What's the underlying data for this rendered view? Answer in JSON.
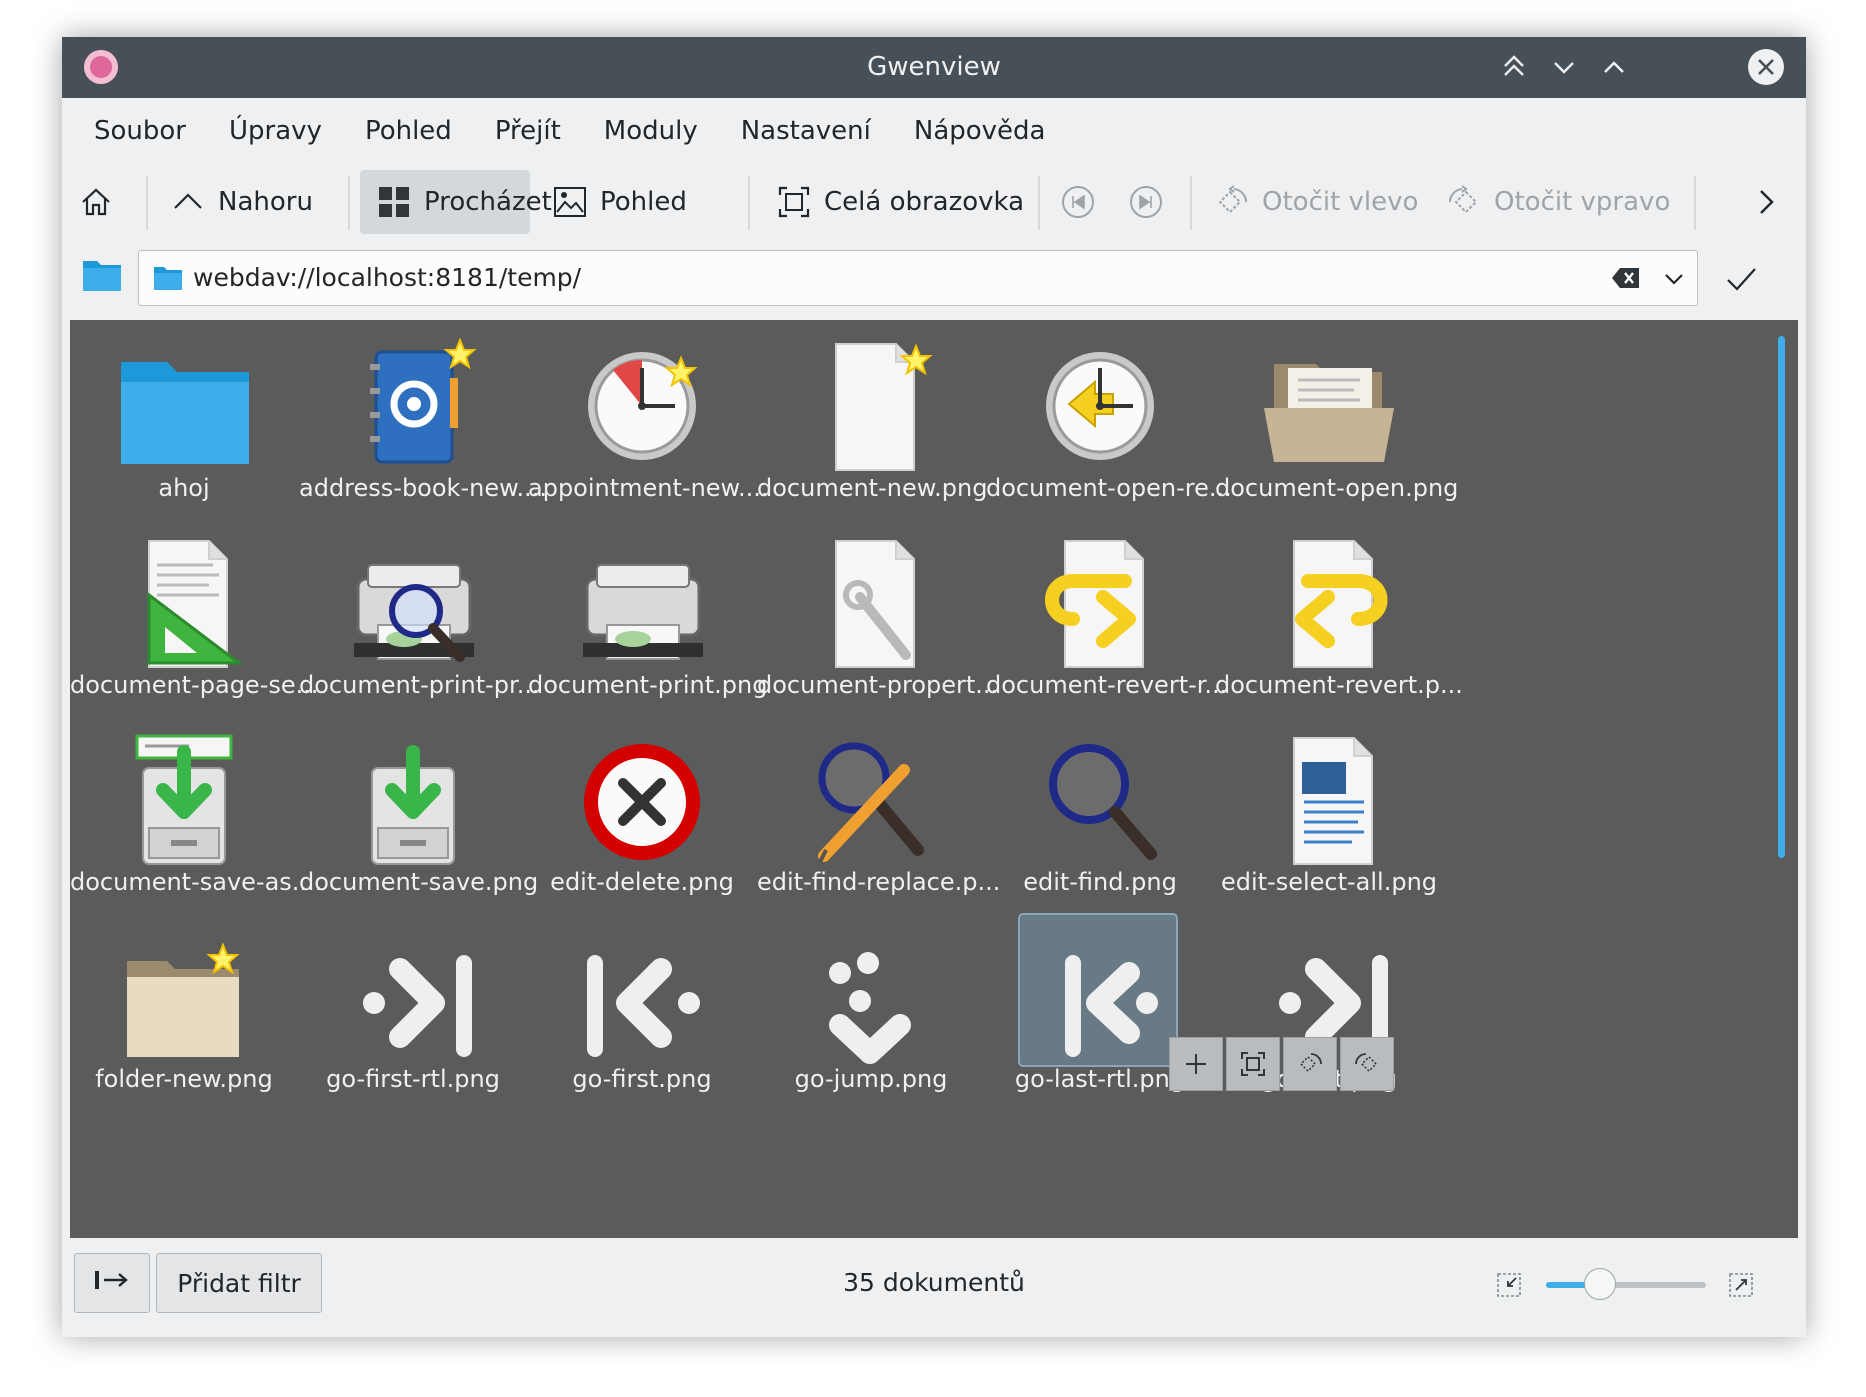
{
  "window": {
    "title": "Gwenview"
  },
  "menu": [
    "Soubor",
    "Úpravy",
    "Pohled",
    "Přejít",
    "Moduly",
    "Nastavení",
    "Nápověda"
  ],
  "toolbar": {
    "up_label": "Nahoru",
    "browse_label": "Procházet",
    "view_label": "Pohled",
    "fullscreen_label": "Celá obrazovka",
    "rotate_left_label": "Otočit vlevo",
    "rotate_right_label": "Otočit vpravo"
  },
  "location": {
    "url": "webdav://localhost:8181/temp/"
  },
  "files": [
    {
      "label": "ahoj",
      "icon": "folder-blue-icon"
    },
    {
      "label": "address-book-new....",
      "icon": "address-book-icon"
    },
    {
      "label": "appointment-new....",
      "icon": "clock-star-icon"
    },
    {
      "label": "document-new.png",
      "icon": "document-new-icon"
    },
    {
      "label": "document-open-re...",
      "icon": "clock-recent-icon"
    },
    {
      "label": "document-open.png",
      "icon": "folder-open-icon"
    },
    {
      "label": "document-page-se...",
      "icon": "page-setup-icon"
    },
    {
      "label": "document-print-pr...",
      "icon": "print-preview-icon"
    },
    {
      "label": "document-print.png",
      "icon": "printer-icon"
    },
    {
      "label": "document-propert...",
      "icon": "document-properties-icon"
    },
    {
      "label": "document-revert-r...",
      "icon": "document-revert-rtl-icon"
    },
    {
      "label": "document-revert.p...",
      "icon": "document-revert-icon"
    },
    {
      "label": "document-save-as....",
      "icon": "save-as-icon"
    },
    {
      "label": "document-save.png",
      "icon": "save-icon"
    },
    {
      "label": "edit-delete.png",
      "icon": "delete-icon"
    },
    {
      "label": "edit-find-replace.p...",
      "icon": "find-replace-icon"
    },
    {
      "label": "edit-find.png",
      "icon": "find-icon"
    },
    {
      "label": "edit-select-all.png",
      "icon": "select-all-icon"
    },
    {
      "label": "folder-new.png",
      "icon": "folder-new-icon"
    },
    {
      "label": "go-first-rtl.png",
      "icon": "go-first-rtl-icon"
    },
    {
      "label": "go-first.png",
      "icon": "go-first-icon"
    },
    {
      "label": "go-jump.png",
      "icon": "go-jump-icon"
    },
    {
      "label": "go-last-rtl.png",
      "icon": "go-last-rtl-icon"
    },
    {
      "label": "go-last.png",
      "icon": "go-last-icon"
    }
  ],
  "hovered_item": "go-last-rtl.png",
  "status": {
    "add_filter_label": "Přidat filtr",
    "document_count": "35 dokumentů",
    "zoom_level": 0.34
  },
  "colors": {
    "titlebar": "#475057",
    "accent": "#3daee9",
    "grid_background": "#5b5b5b",
    "window_background": "#eff0f1"
  }
}
